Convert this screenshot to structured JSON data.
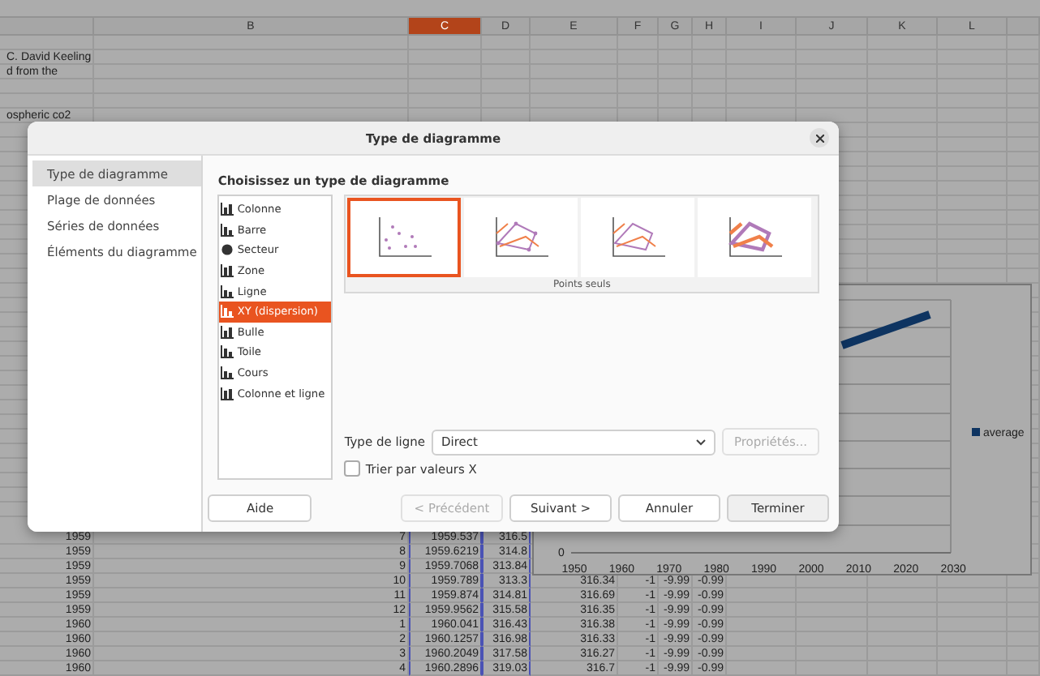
{
  "sheet": {
    "columns": [
      {
        "selected": false,
        "in_range": false
      },
      {
        "label": "B",
        "selected": false,
        "in_range": false
      },
      {
        "label": "C",
        "selected": true,
        "in_range": true
      },
      {
        "label": "D",
        "selected": false,
        "in_range": true
      },
      {
        "label": "E",
        "selected": false,
        "in_range": false
      },
      {
        "label": "F",
        "selected": false,
        "in_range": false
      },
      {
        "label": "G",
        "selected": false,
        "in_range": false
      },
      {
        "label": "H",
        "selected": false,
        "in_range": false
      },
      {
        "label": "I",
        "selected": false,
        "in_range": false
      },
      {
        "label": "J",
        "selected": false,
        "in_range": false
      },
      {
        "label": "K",
        "selected": false,
        "in_range": false
      },
      {
        "label": "L",
        "selected": false,
        "in_range": false
      },
      {
        "selected": false,
        "in_range": false
      }
    ],
    "top_rows": [
      {},
      {
        "note": "C. David Keeling"
      },
      {
        "note": "d from the"
      },
      {},
      {},
      {
        "note": "ospheric co2"
      }
    ],
    "rows": [
      {
        "cells": [
          "1959",
          "7",
          "1959.537",
          "316.5"
        ]
      },
      {
        "cells": [
          "1959",
          "8",
          "1959.6219",
          "314.8"
        ]
      },
      {
        "cells": [
          "1959",
          "9",
          "1959.7068",
          "313.84"
        ]
      },
      {
        "cells": [
          "1959",
          "10",
          "1959.789",
          "313.3",
          "316.34",
          "-1",
          "-9.99",
          "-0.99"
        ]
      },
      {
        "cells": [
          "1959",
          "11",
          "1959.874",
          "314.81",
          "316.69",
          "-1",
          "-9.99",
          "-0.99"
        ]
      },
      {
        "cells": [
          "1959",
          "12",
          "1959.9562",
          "315.58",
          "316.35",
          "-1",
          "-9.99",
          "-0.99"
        ]
      },
      {
        "cells": [
          "1960",
          "1",
          "1960.041",
          "316.43",
          "316.38",
          "-1",
          "-9.99",
          "-0.99"
        ]
      },
      {
        "cells": [
          "1960",
          "2",
          "1960.1257",
          "316.98",
          "316.33",
          "-1",
          "-9.99",
          "-0.99"
        ]
      },
      {
        "cells": [
          "1960",
          "3",
          "1960.2049",
          "317.58",
          "316.27",
          "-1",
          "-9.99",
          "-0.99"
        ]
      },
      {
        "cells": [
          "1960",
          "4",
          "1960.2896",
          "319.03",
          "316.7",
          "-1",
          "-9.99",
          "-0.99"
        ]
      }
    ]
  },
  "chart": {
    "y_tick": "0",
    "x_ticks": [
      "1950",
      "1960",
      "1970",
      "1980",
      "1990",
      "2000",
      "2010",
      "2020",
      "2030"
    ],
    "legend": "average"
  },
  "dialog": {
    "title": "Type de diagramme",
    "steps": [
      {
        "label": "Type de diagramme",
        "selected": true
      },
      {
        "label": "Plage de données",
        "selected": false
      },
      {
        "label": "Séries de données",
        "selected": false
      },
      {
        "label": "Éléments du diagramme",
        "selected": false
      }
    ],
    "heading": "Choisissez un type de diagramme",
    "types": [
      {
        "label": "Colonne",
        "selected": false
      },
      {
        "label": "Barre",
        "selected": false
      },
      {
        "label": "Secteur",
        "selected": false
      },
      {
        "label": "Zone",
        "selected": false
      },
      {
        "label": "Ligne",
        "selected": false
      },
      {
        "label": "XY (dispersion)",
        "selected": true
      },
      {
        "label": "Bulle",
        "selected": false
      },
      {
        "label": "Toile",
        "selected": false
      },
      {
        "label": "Cours",
        "selected": false
      },
      {
        "label": "Colonne et ligne",
        "selected": false
      }
    ],
    "variants": [
      {
        "selected": true
      },
      {
        "selected": false
      },
      {
        "selected": false
      },
      {
        "selected": false
      }
    ],
    "variant_caption": "Points seuls",
    "line_type": {
      "label": "Type de ligne",
      "value": "Direct"
    },
    "properties_button": {
      "label": "Propriétés...",
      "disabled": true
    },
    "sort_checkbox": {
      "label": "Trier par valeurs X",
      "checked": false
    },
    "help_button": "Aide",
    "buttons": [
      {
        "label": "< Précédent",
        "disabled": true,
        "default": false
      },
      {
        "label": "Suivant >",
        "disabled": false,
        "default": false
      },
      {
        "label": "Annuler",
        "disabled": false,
        "default": false
      },
      {
        "label": "Terminer",
        "disabled": false,
        "default": true
      }
    ]
  }
}
